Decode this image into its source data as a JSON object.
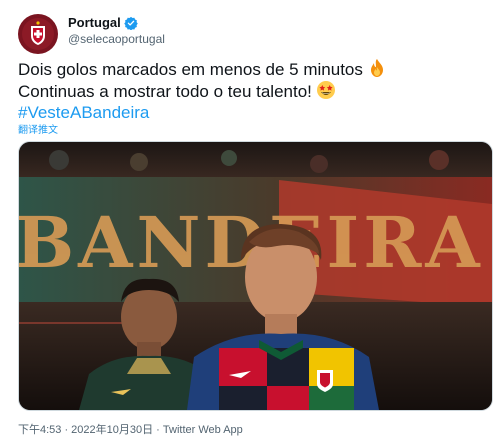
{
  "author": {
    "name": "Portugal",
    "handle": "@selecaoportugal",
    "verified": true
  },
  "tweet": {
    "line1": "Dois golos marcados em menos de 5 minutos",
    "line2": "Continuas a mostrar todo o teu talento!",
    "hashtag": "#VesteABandeira",
    "line1_emoji": "fire-emoji",
    "line2_emoji": "star-struck-emoji"
  },
  "translate_label": "翻译推文",
  "media": {
    "banner_text": "BANDEIRA",
    "description": "photo"
  },
  "timestamp": "下午4:53 · 2022年10月30日 · Twitter Web App",
  "colors": {
    "link": "#1d9bf0",
    "verified": "#1d9bf0",
    "secondary_text": "#536471",
    "brand_red": "#7a1420"
  }
}
